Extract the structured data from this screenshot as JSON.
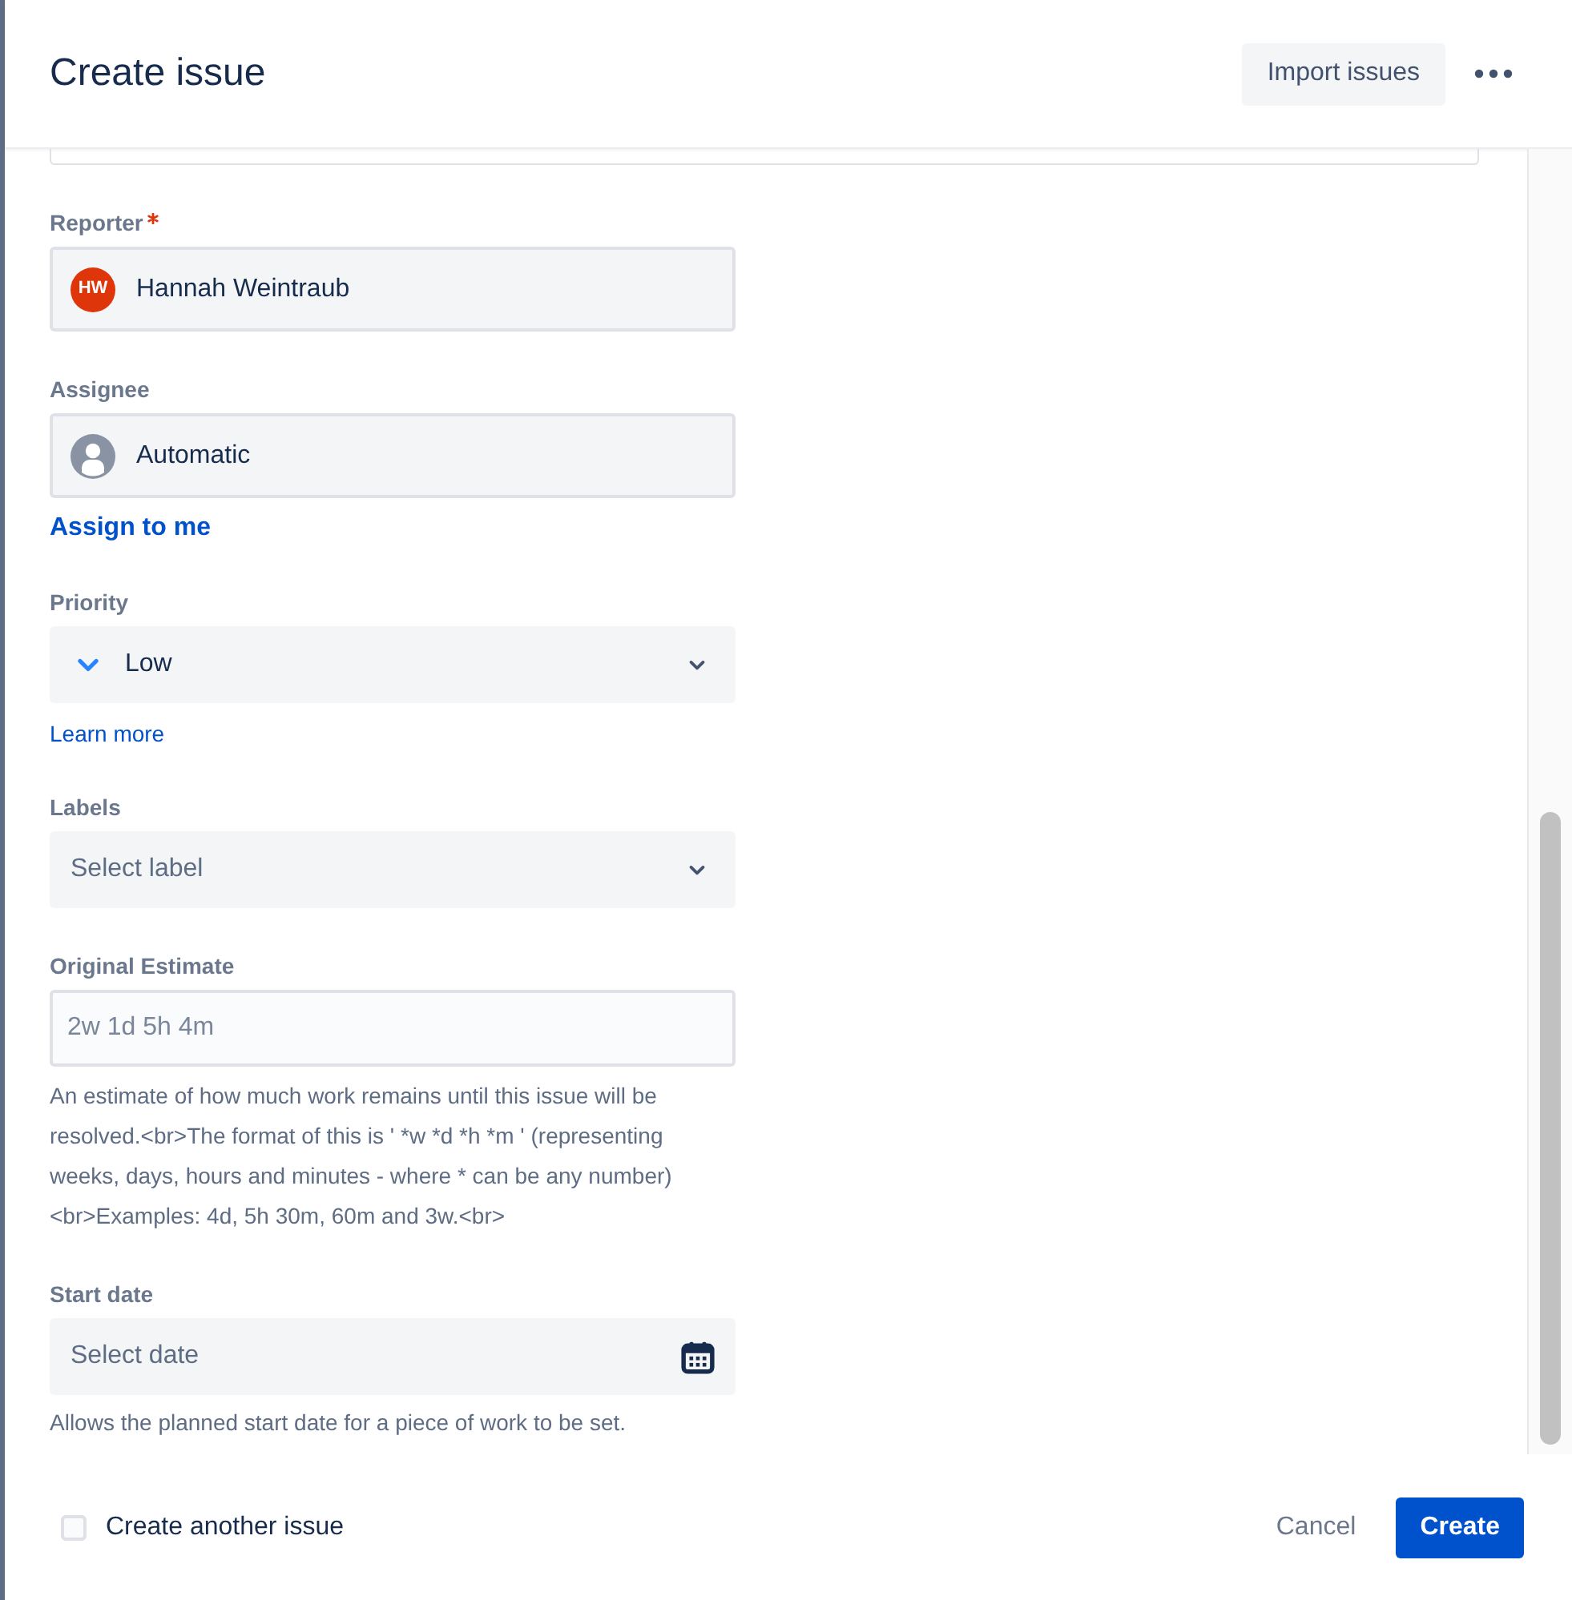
{
  "header": {
    "title": "Create issue",
    "import_button": {
      "label": "Import issues"
    }
  },
  "fields": [
    {
      "kind": "user",
      "label": "Reporter",
      "required": true,
      "value": "Hannah Weintraub",
      "avatar": {
        "kind": "initials",
        "text": "HW"
      }
    },
    {
      "kind": "user",
      "label": "Assignee",
      "required": false,
      "value": "Automatic",
      "avatar": {
        "kind": "generic"
      },
      "link": {
        "kind": "action",
        "text": "Assign to me"
      }
    },
    {
      "kind": "priority",
      "label": "Priority",
      "required": false,
      "value": "Low",
      "link": {
        "kind": "help",
        "text": "Learn more"
      }
    },
    {
      "kind": "select",
      "label": "Labels",
      "required": false,
      "placeholder": "Select label"
    },
    {
      "kind": "text",
      "label": "Original Estimate",
      "required": false,
      "placeholder": "2w 1d 5h 4m",
      "help": "An estimate of how much work remains until this issue will be resolved.<br>The format of this is ' *w *d *h *m ' (representing weeks, days, hours and minutes - where * can be any number)<br>Examples: 4d, 5h 30m, 60m and 3w.<br>"
    },
    {
      "kind": "date",
      "label": "Start date",
      "required": false,
      "placeholder": "Select date",
      "help": "Allows the planned start date for a piece of work to be set."
    }
  ],
  "footer": {
    "create_another": {
      "label": "Create another issue",
      "checked": false
    },
    "buttons": [
      {
        "kind": "secondary",
        "label": "Cancel"
      },
      {
        "kind": "primary",
        "label": "Create"
      }
    ]
  }
}
